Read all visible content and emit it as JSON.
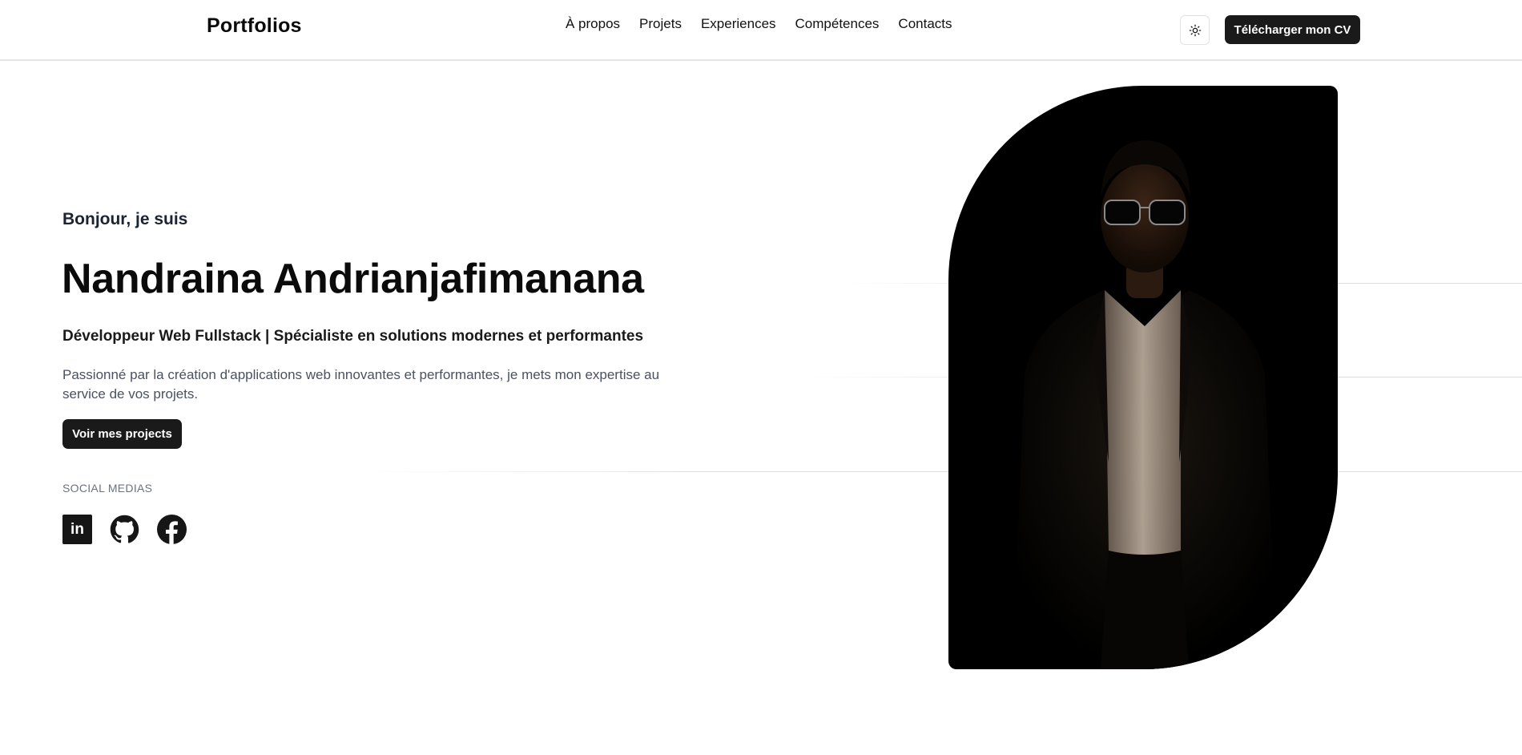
{
  "header": {
    "logo": "Portfolios",
    "nav": [
      {
        "label": "À propos"
      },
      {
        "label": "Projets"
      },
      {
        "label": "Experiences"
      },
      {
        "label": "Compétences"
      },
      {
        "label": "Contacts"
      }
    ],
    "theme_toggle_icon": "sun-icon",
    "cv_button_label": "Télécharger mon CV"
  },
  "hero": {
    "greeting": "Bonjour, je suis",
    "name": "Nandraina Andrianjafimanana",
    "role": "Développeur Web Fullstack | Spécialiste en solutions modernes et performantes",
    "description": "Passionné par la création d'applications web innovantes et performantes, je mets mon expertise au service de vos projets.",
    "projects_button_label": "Voir mes projects",
    "social_title": "SOCIAL MEDIAS",
    "social_links": [
      {
        "icon": "linkedin-icon",
        "glyph": "in"
      },
      {
        "icon": "github-icon"
      },
      {
        "icon": "facebook-icon"
      }
    ]
  },
  "colors": {
    "primary_dark": "#1a1a1a",
    "background": "#ffffff",
    "muted_text": "#4a5160",
    "portrait_bg": "#000000"
  }
}
